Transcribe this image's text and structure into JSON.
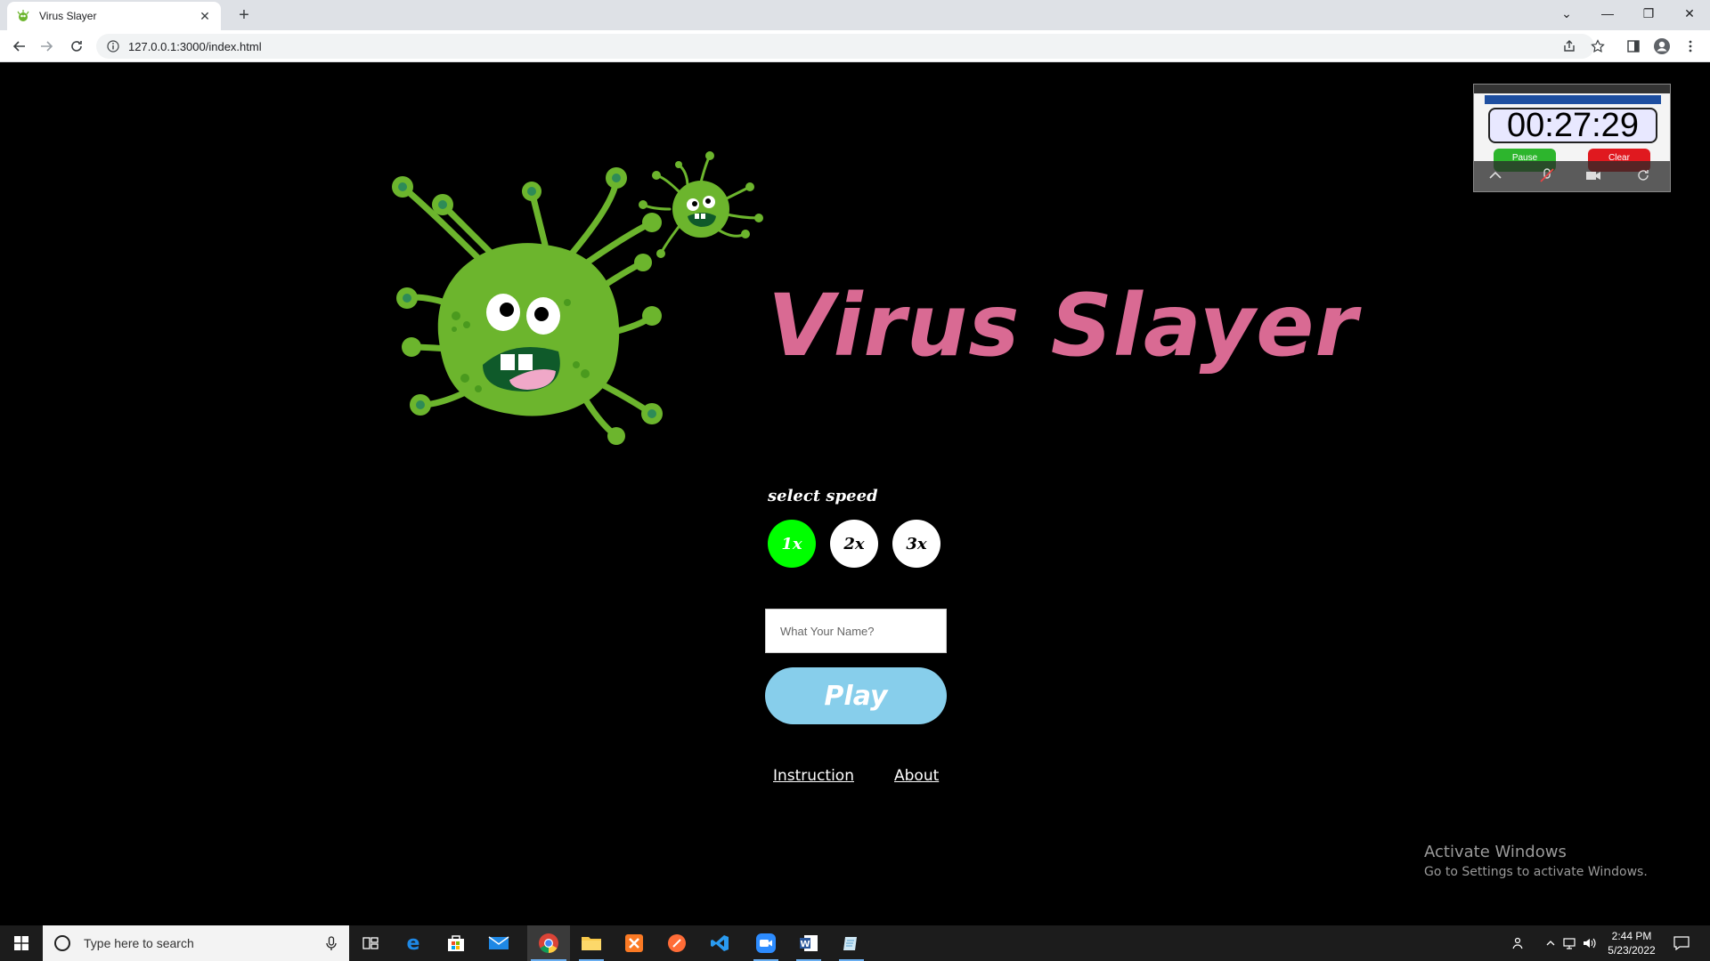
{
  "browser": {
    "tab_title": "Virus Slayer",
    "url": "127.0.0.1:3000/index.html",
    "icons": [
      "virus-favicon",
      "close-icon",
      "plus-icon",
      "back-icon",
      "forward-icon",
      "reload-icon",
      "info-icon",
      "share-icon",
      "star-icon",
      "sidepanel-icon",
      "profile-icon",
      "menu-icon"
    ]
  },
  "game": {
    "title": "Virus Slayer",
    "speed_label": "select speed",
    "speeds": [
      "1x",
      "2x",
      "3x"
    ],
    "selected_speed": "1x",
    "name_placeholder": "What Your Name?",
    "play_label": "Play",
    "links": {
      "instruction": "Instruction",
      "about": "About"
    },
    "colors": {
      "title": "#d96a93",
      "active_speed": "#00ff00",
      "play": "#87ceeb",
      "virus": "#6cb52d"
    }
  },
  "stopwatch": {
    "time": "00:27:29",
    "pause_label": "Pause",
    "clear_label": "Clear"
  },
  "watermark": {
    "line1": "Activate Windows",
    "line2": "Go to Settings to activate Windows."
  },
  "taskbar": {
    "search_placeholder": "Type here to search",
    "time": "2:44 PM",
    "date": "5/23/2022",
    "apps": [
      "task-view",
      "edge",
      "store",
      "mail",
      "chrome",
      "file-explorer",
      "xampp",
      "postman",
      "vscode",
      "zoom",
      "word",
      "notepad"
    ]
  }
}
